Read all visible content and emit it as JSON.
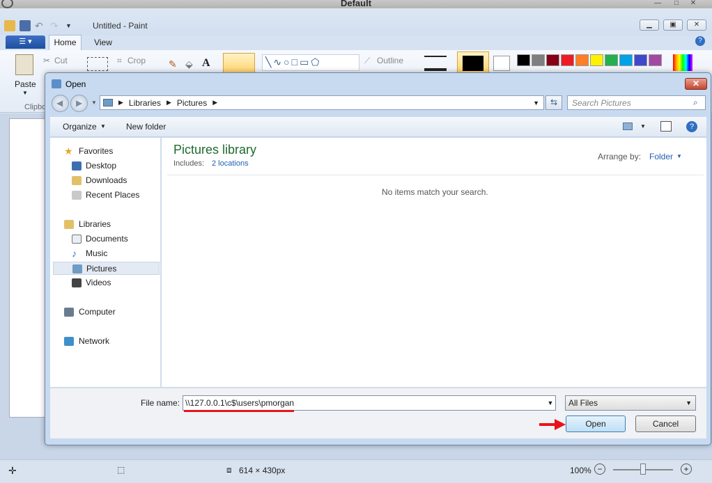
{
  "host": {
    "title": "Default"
  },
  "paint": {
    "window_title": "Untitled - Paint",
    "tabs": {
      "home": "Home",
      "view": "View"
    },
    "clipboard": {
      "paste": "Paste",
      "cut": "Cut",
      "group": "Clipboard"
    },
    "image": {
      "crop": "Crop"
    },
    "shapes": {
      "outline": "Outline"
    },
    "status": {
      "size": "614 × 430px",
      "zoom": "100%"
    },
    "palette": [
      "#000000",
      "#7f7f7f",
      "#880015",
      "#ed1c24",
      "#ff7f27",
      "#fff200",
      "#22b14c",
      "#00a2e8",
      "#3f48cc",
      "#a349a4"
    ]
  },
  "dialog": {
    "title": "Open",
    "breadcrumb": [
      "Libraries",
      "Pictures"
    ],
    "search_placeholder": "Search Pictures",
    "toolbar": {
      "organize": "Organize",
      "new_folder": "New folder"
    },
    "nav": {
      "favorites": "Favorites",
      "desktop": "Desktop",
      "downloads": "Downloads",
      "recent": "Recent Places",
      "libraries": "Libraries",
      "documents": "Documents",
      "music": "Music",
      "pictures": "Pictures",
      "videos": "Videos",
      "computer": "Computer",
      "network": "Network"
    },
    "library": {
      "title": "Pictures library",
      "includes": "Includes:",
      "locations": "2 locations",
      "arrange_label": "Arrange by:",
      "arrange_value": "Folder",
      "empty_msg": "No items match your search."
    },
    "file_name_label": "File name:",
    "file_name_value": "\\\\127.0.0.1\\c$\\users\\pmorgan",
    "file_type": "All Files",
    "open": "Open",
    "cancel": "Cancel"
  }
}
